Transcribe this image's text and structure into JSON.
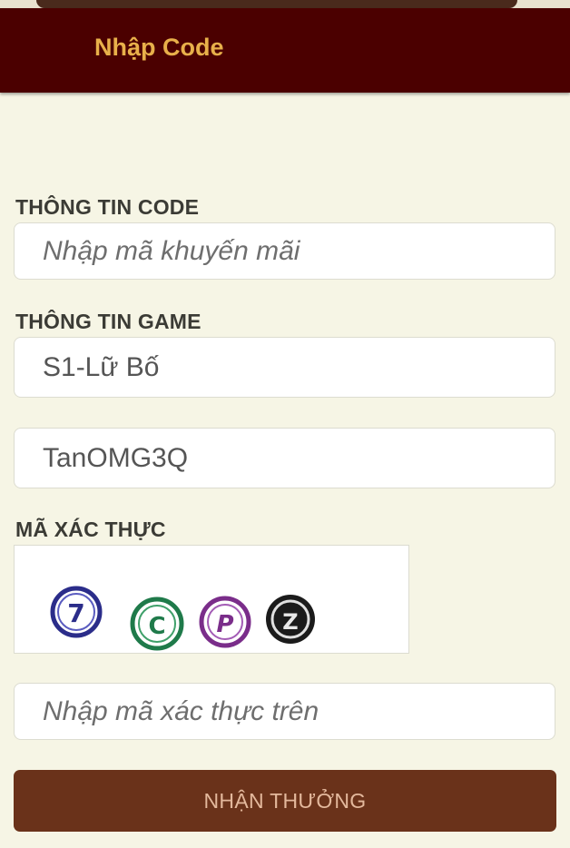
{
  "header": {
    "title": "Nhập Code"
  },
  "code_section": {
    "label": "THÔNG TIN CODE",
    "promo_placeholder": "Nhập mã khuyến mãi"
  },
  "game_section": {
    "label": "THÔNG TIN GAME",
    "server_value": "S1-Lữ Bố",
    "character_value": "TanOMG3Q"
  },
  "verify_section": {
    "label": "MÃ XÁC THỰC",
    "captcha_chars": [
      "7",
      "C",
      "P",
      "Z"
    ],
    "captcha_placeholder": "Nhập mã xác thực trên"
  },
  "submit_label": "NHẬN THƯỞNG",
  "colors": {
    "header_bg": "#4b0000",
    "header_title": "#e8b04a",
    "page_bg": "#f6f5e5",
    "button_bg": "#6a321a",
    "button_text": "#e3b89c"
  }
}
